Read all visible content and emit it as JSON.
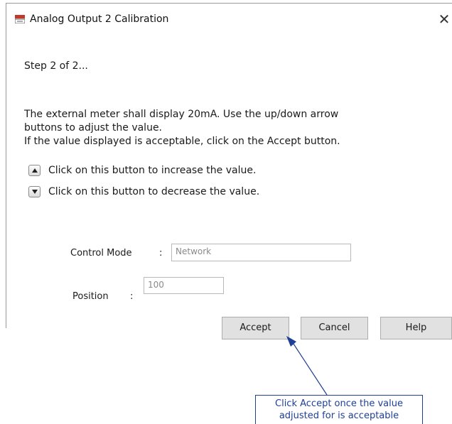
{
  "window": {
    "title": "Analog Output 2 Calibration",
    "close_glyph": "✕"
  },
  "step_text": "Step 2 of 2...",
  "instructions": {
    "line1": "The external meter shall display 20mA. Use the up/down arrow",
    "line2": "buttons to adjust the value.",
    "line3": "If the value displayed is acceptable, click on the Accept button."
  },
  "arrows": {
    "up_label": "Click on this button to increase the value.",
    "down_label": "Click on this button to decrease the value."
  },
  "fields": {
    "control_mode_label": "Control Mode",
    "control_mode_sep": ":",
    "control_mode_value": "Network",
    "position_label": "Position",
    "position_sep": ":",
    "position_value": "100"
  },
  "buttons": {
    "accept": "Accept",
    "cancel": "Cancel",
    "help": "Help"
  },
  "callout": {
    "line1": "Click Accept once the value",
    "line2": "adjusted for is acceptable"
  },
  "colors": {
    "annotation": "#1f3f95",
    "button_face": "#e1e1e1",
    "icon_red": "#c0392b"
  },
  "icons": {
    "app": "dcm-logo-icon",
    "close": "close-icon",
    "up": "arrow-up-icon",
    "down": "arrow-down-icon"
  }
}
